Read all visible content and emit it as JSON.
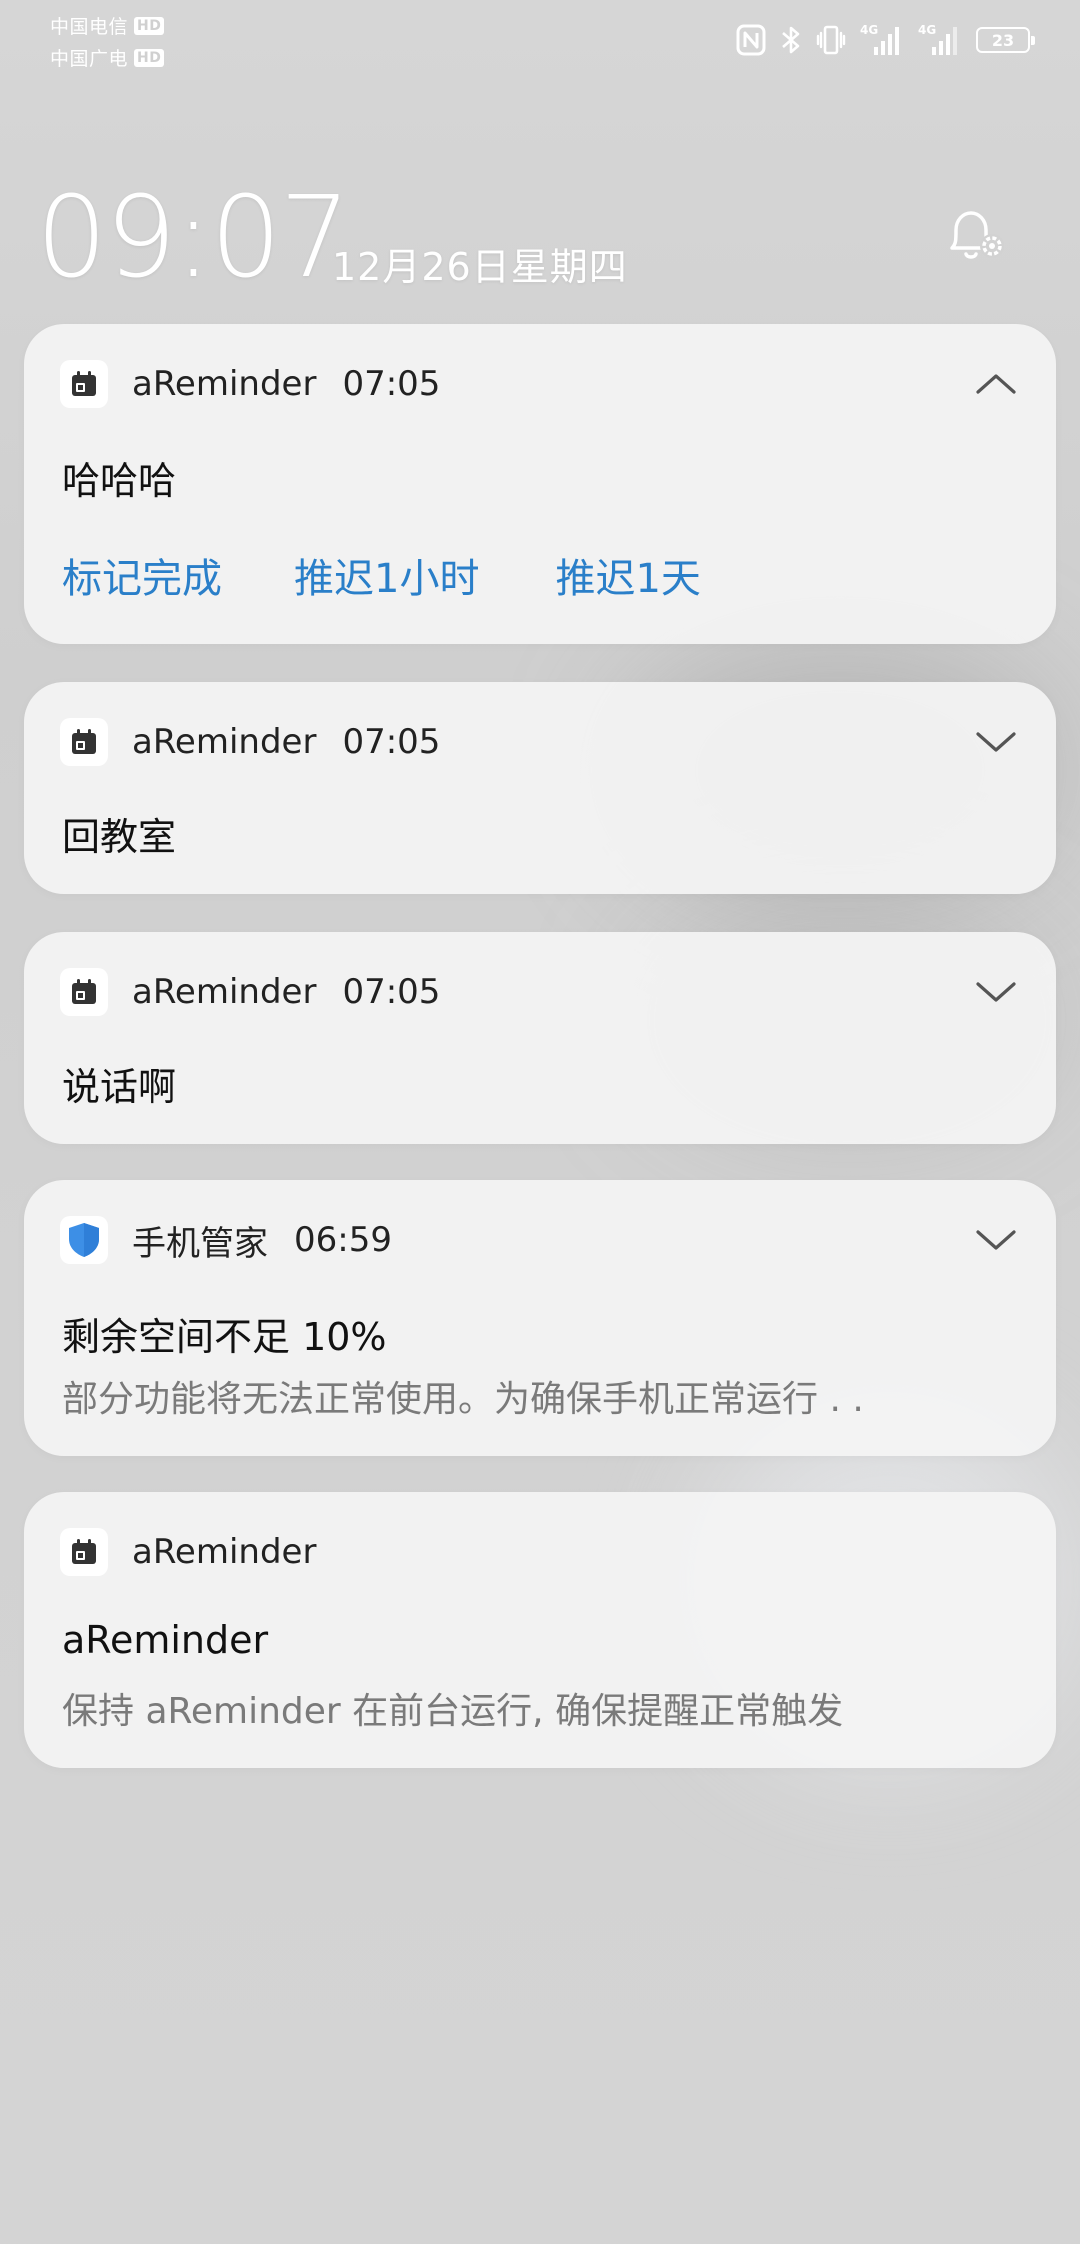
{
  "status_bar": {
    "carrier_1": "中国电信",
    "carrier_2": "中国广电",
    "hd_badge": "HD",
    "network_1": "4G",
    "network_2": "4G",
    "battery": "23",
    "icons": [
      "nfc-icon",
      "bluetooth-icon",
      "vibrate-icon",
      "signal-icon",
      "signal-icon",
      "battery-icon"
    ]
  },
  "lock": {
    "time": "09:07",
    "date": "12月26日星期四"
  },
  "notifications": [
    {
      "app": "aReminder",
      "time": "07:05",
      "icon": "calendar-icon",
      "title": "哈哈哈",
      "expanded": true,
      "actions": [
        "标记完成",
        "推迟1小时",
        "推迟1天"
      ]
    },
    {
      "app": "aReminder",
      "time": "07:05",
      "icon": "calendar-icon",
      "title": "回教室",
      "expanded": false
    },
    {
      "app": "aReminder",
      "time": "07:05",
      "icon": "calendar-icon",
      "title": "说话啊",
      "expanded": false
    },
    {
      "app": "手机管家",
      "time": "06:59",
      "icon": "shield-icon",
      "title": "剩余空间不足 10%",
      "body": "部分功能将无法正常使用。为确保手机正常运行 . .",
      "expanded": false
    },
    {
      "app": "aReminder",
      "icon": "calendar-icon",
      "title": "aReminder",
      "body": "保持 aReminder 在前台运行, 确保提醒正常触发"
    }
  ],
  "colors": {
    "action_blue": "#2a7fc9",
    "card_bg": "#f4f4f4",
    "shield_blue": "#3d8fe6"
  }
}
